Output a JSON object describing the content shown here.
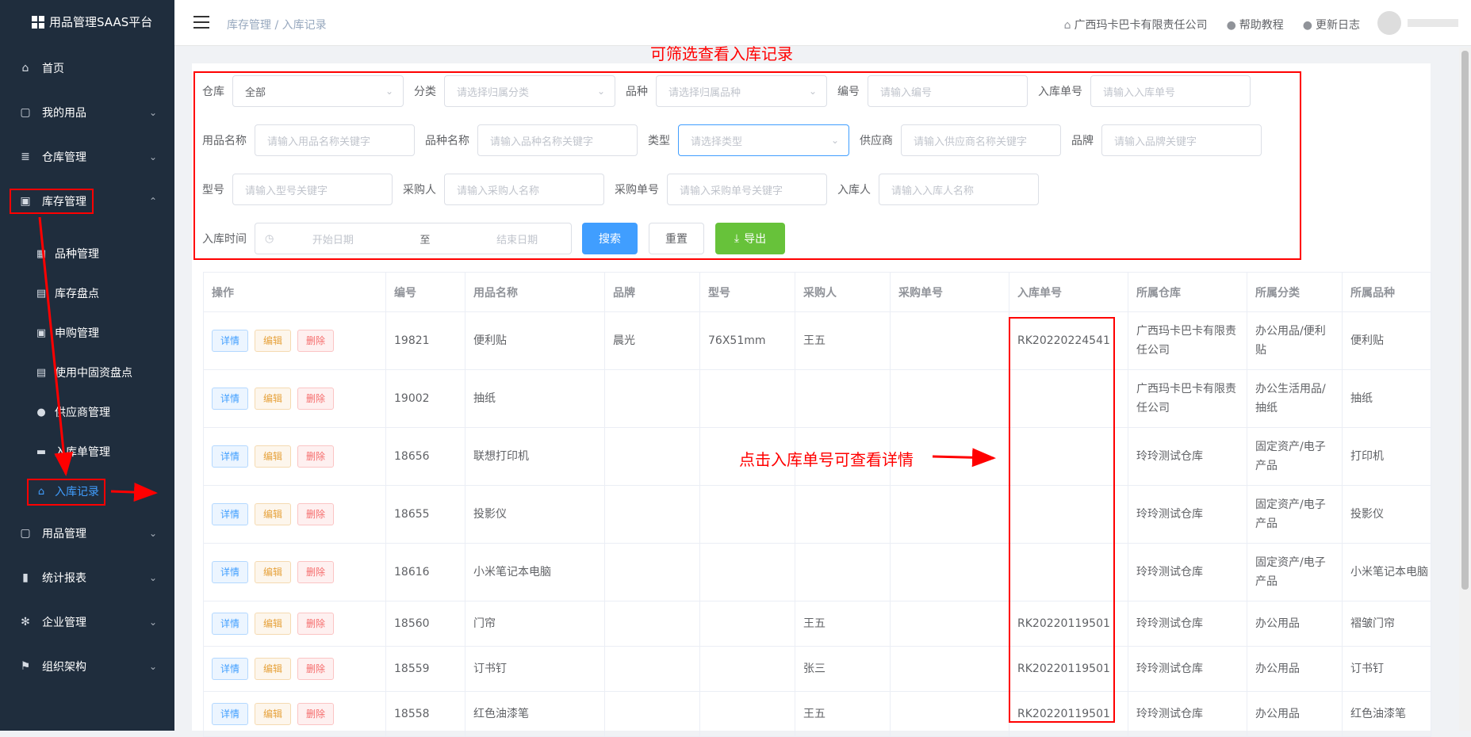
{
  "app": {
    "title": "用品管理SAAS平台"
  },
  "sidebar": {
    "items": [
      {
        "label": "首页",
        "icon": "home-icon"
      },
      {
        "label": "我的用品",
        "icon": "bag-icon"
      },
      {
        "label": "仓库管理",
        "icon": "database-icon"
      },
      {
        "label": "库存管理",
        "icon": "box-icon"
      },
      {
        "label": "用品管理",
        "icon": "box-icon"
      },
      {
        "label": "统计报表",
        "icon": "chart-icon"
      },
      {
        "label": "企业管理",
        "icon": "gear-icon"
      },
      {
        "label": "组织架构",
        "icon": "flag-icon"
      }
    ],
    "sub_items": [
      {
        "label": "品种管理",
        "icon": "grid-icon"
      },
      {
        "label": "库存盘点",
        "icon": "doc-icon"
      },
      {
        "label": "申购管理",
        "icon": "lock-icon"
      },
      {
        "label": "使用中固资盘点",
        "icon": "doc-icon"
      },
      {
        "label": "供应商管理",
        "icon": "user-icon"
      },
      {
        "label": "入库单管理",
        "icon": "printer-icon"
      },
      {
        "label": "入库记录",
        "icon": "home-icon"
      }
    ]
  },
  "header": {
    "breadcrumb": "库存管理 / 入库记录",
    "company": "广西玛卡巴卡有限责任公司",
    "help": "帮助教程",
    "changelog": "更新日志"
  },
  "filters": {
    "warehouse_label": "仓库",
    "warehouse_value": "全部",
    "category_label": "分类",
    "category_placeholder": "请选择归属分类",
    "variety_label": "品种",
    "variety_placeholder": "请选择归属品种",
    "code_label": "编号",
    "code_placeholder": "请输入编号",
    "inbound_no_label": "入库单号",
    "inbound_no_placeholder": "请输入入库单号",
    "item_name_label": "用品名称",
    "item_name_placeholder": "请输入用品名称关键字",
    "variety_name_label": "品种名称",
    "variety_name_placeholder": "请输入品种名称关键字",
    "type_label": "类型",
    "type_placeholder": "请选择类型",
    "supplier_label": "供应商",
    "supplier_placeholder": "请输入供应商名称关键字",
    "brand_label": "品牌",
    "brand_placeholder": "请输入品牌关键字",
    "model_label": "型号",
    "model_placeholder": "请输入型号关键字",
    "buyer_label": "采购人",
    "buyer_placeholder": "请输入采购人名称",
    "purchase_no_label": "采购单号",
    "purchase_no_placeholder": "请输入采购单号关键字",
    "receiver_label": "入库人",
    "receiver_placeholder": "请输入入库人名称",
    "time_label": "入库时间",
    "start_placeholder": "开始日期",
    "to": "至",
    "end_placeholder": "结束日期",
    "search_btn": "搜索",
    "reset_btn": "重置",
    "export_btn": "导出"
  },
  "table": {
    "columns": [
      "操作",
      "编号",
      "用品名称",
      "品牌",
      "型号",
      "采购人",
      "采购单号",
      "入库单号",
      "所属仓库",
      "所属分类",
      "所属品种"
    ],
    "actions": {
      "detail": "详情",
      "edit": "编辑",
      "delete": "删除"
    },
    "rows": [
      {
        "code": "19821",
        "name": "便利贴",
        "brand": "晨光",
        "model": "76X51mm",
        "buyer": "王五",
        "purchase_no": "",
        "inbound_no": "RK20220224541",
        "warehouse": "广西玛卡巴卡有限责任公司",
        "category": "办公用品/便利贴",
        "variety": "便利贴"
      },
      {
        "code": "19002",
        "name": "抽纸",
        "brand": "",
        "model": "",
        "buyer": "",
        "purchase_no": "",
        "inbound_no": "",
        "warehouse": "广西玛卡巴卡有限责任公司",
        "category": "办公生活用品/抽纸",
        "variety": "抽纸"
      },
      {
        "code": "18656",
        "name": "联想打印机",
        "brand": "",
        "model": "",
        "buyer": "",
        "purchase_no": "",
        "inbound_no": "",
        "warehouse": "玲玲测试仓库",
        "category": "固定资产/电子产品",
        "variety": "打印机"
      },
      {
        "code": "18655",
        "name": "投影仪",
        "brand": "",
        "model": "",
        "buyer": "",
        "purchase_no": "",
        "inbound_no": "",
        "warehouse": "玲玲测试仓库",
        "category": "固定资产/电子产品",
        "variety": "投影仪"
      },
      {
        "code": "18616",
        "name": "小米笔记本电脑",
        "brand": "",
        "model": "",
        "buyer": "",
        "purchase_no": "",
        "inbound_no": "",
        "warehouse": "玲玲测试仓库",
        "category": "固定资产/电子产品",
        "variety": "小米笔记本电脑"
      },
      {
        "code": "18560",
        "name": "门帘",
        "brand": "",
        "model": "",
        "buyer": "王五",
        "purchase_no": "",
        "inbound_no": "RK20220119501",
        "warehouse": "玲玲测试仓库",
        "category": "办公用品",
        "variety": "褶皱门帘"
      },
      {
        "code": "18559",
        "name": "订书钉",
        "brand": "",
        "model": "",
        "buyer": "张三",
        "purchase_no": "",
        "inbound_no": "RK20220119501",
        "warehouse": "玲玲测试仓库",
        "category": "办公用品",
        "variety": "订书钉"
      },
      {
        "code": "18558",
        "name": "红色油漆笔",
        "brand": "",
        "model": "",
        "buyer": "王五",
        "purchase_no": "",
        "inbound_no": "RK20220119501",
        "warehouse": "玲玲测试仓库",
        "category": "办公用品",
        "variety": "红色油漆笔"
      }
    ]
  },
  "annotations": {
    "filter_note": "可筛选查看入库记录",
    "detail_note": "点击入库单号可查看详情"
  }
}
